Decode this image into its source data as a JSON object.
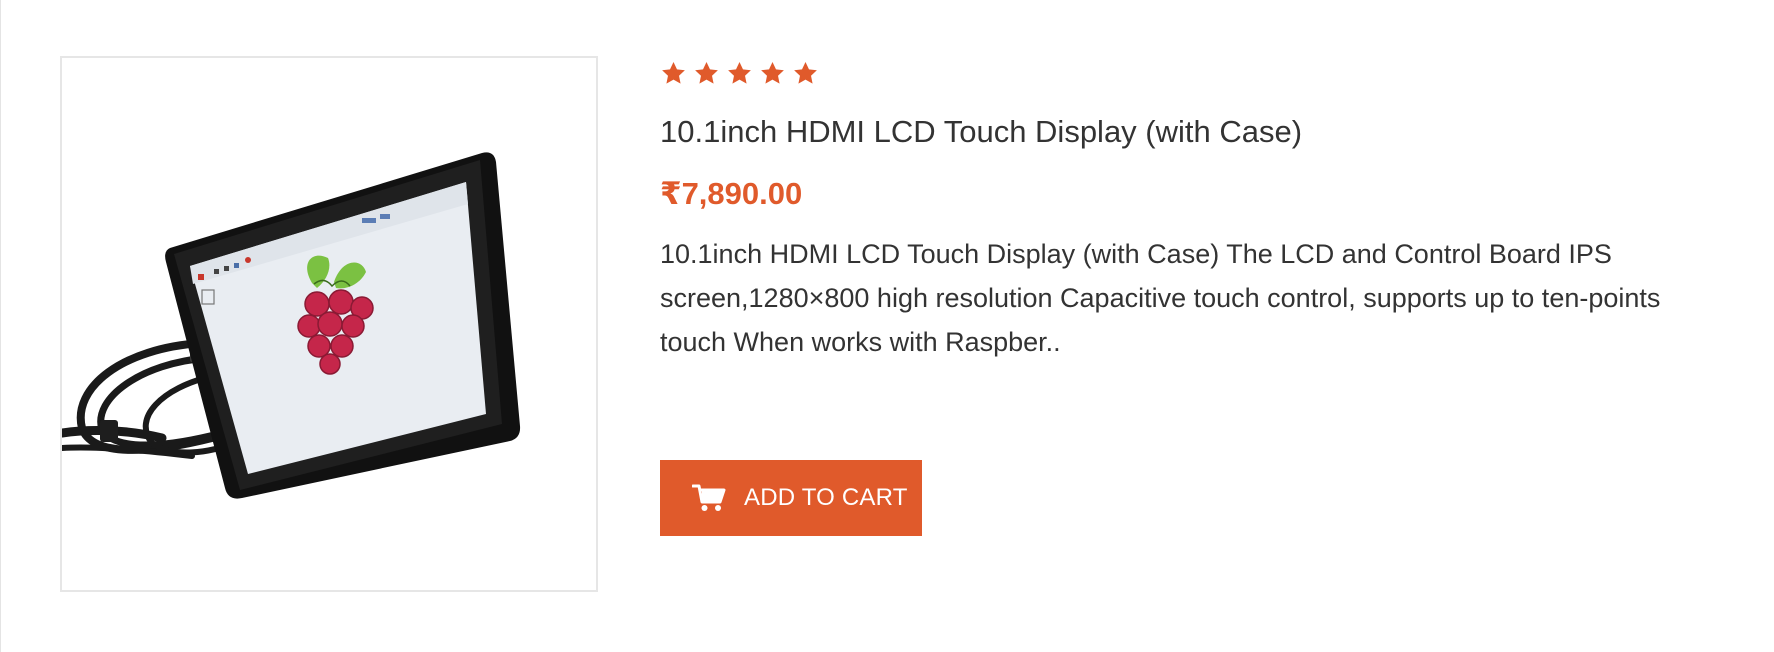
{
  "product": {
    "title": "10.1inch HDMI LCD Touch Display (with Case)",
    "price": "₹7,890.00",
    "description": "10.1inch HDMI LCD Touch Display (with Case) The LCD and Control Board IPS screen,1280×800 high resolution Capacitive touch control, supports up to ten-points touch When works with Raspber..",
    "rating": {
      "stars_filled": 5,
      "stars_total": 5
    },
    "image_icon": "product-photo-lcd-display-raspberry-pi"
  },
  "actions": {
    "add_to_cart_label": "ADD TO CART",
    "add_to_cart_icon": "shopping-cart-icon"
  },
  "colors": {
    "accent": "#e05a2b",
    "text": "#333333",
    "border": "#e6e6e6"
  }
}
